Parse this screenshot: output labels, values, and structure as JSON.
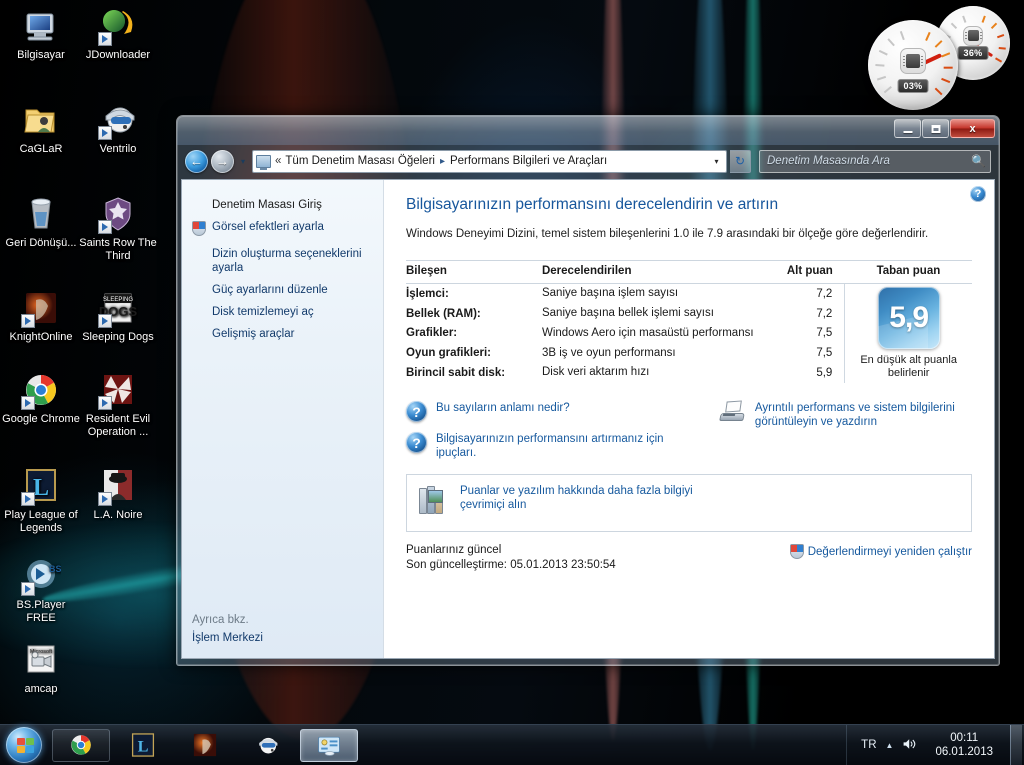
{
  "desktop": {
    "icons": [
      {
        "label": "Bilgisayar",
        "icon": "computer-icon",
        "shortcut": false
      },
      {
        "label": "JDownloader",
        "icon": "jdownloader-icon",
        "shortcut": true
      },
      {
        "label": "CaGLaR",
        "icon": "user-folder-icon",
        "shortcut": false
      },
      {
        "label": "Ventrilo",
        "icon": "ventrilo-icon",
        "shortcut": true
      },
      {
        "label": "Geri Dönüşü...",
        "icon": "recycle-bin-icon",
        "shortcut": false
      },
      {
        "label": "Saints Row The Third",
        "icon": "saints-row-icon",
        "shortcut": true
      },
      {
        "label": "KnightOnline",
        "icon": "knightonline-icon",
        "shortcut": true
      },
      {
        "label": "Sleeping Dogs",
        "icon": "sleeping-dogs-icon",
        "shortcut": true
      },
      {
        "label": "Google Chrome",
        "icon": "chrome-icon",
        "shortcut": true
      },
      {
        "label": "Resident Evil Operation ...",
        "icon": "resident-evil-icon",
        "shortcut": true
      },
      {
        "label": "Play League of Legends",
        "icon": "league-of-legends-icon",
        "shortcut": true
      },
      {
        "label": "L.A. Noire",
        "icon": "la-noire-icon",
        "shortcut": true
      },
      {
        "label": "BS.Player FREE",
        "icon": "bsplayer-icon",
        "shortcut": true
      },
      {
        "label": "amcap",
        "icon": "amcap-icon",
        "shortcut": false
      }
    ]
  },
  "gadget": {
    "cpu_value": "03%",
    "ram_value": "36%",
    "cpu_icon": "cpu-chip-icon",
    "ram_icon": "memory-chip-icon"
  },
  "window": {
    "controls": {
      "minimize": "minimize-button",
      "maximize": "maximize-button",
      "close_label": "x"
    },
    "nav": {
      "back_glyph": "←",
      "forward_glyph": "→",
      "recent_glyph": "▾",
      "refresh_glyph": "↻"
    },
    "address": {
      "chevrons": "«",
      "crumbs": [
        "Tüm Denetim Masası Öğeleri",
        "Performans Bilgileri ve Araçları"
      ],
      "separator": "▸",
      "dropdown_glyph": "▾"
    },
    "search": {
      "placeholder": "Denetim Masasında Ara",
      "icon": "search-icon"
    },
    "help_label": "?"
  },
  "sidebar": {
    "items": [
      {
        "label": "Denetim Masası Giriş",
        "icon": null
      },
      {
        "label": "Görsel efektleri ayarla",
        "icon": "uac-shield-icon"
      },
      {
        "label": "Dizin oluşturma seçeneklerini ayarla",
        "icon": null
      },
      {
        "label": "Güç ayarlarını düzenle",
        "icon": null
      },
      {
        "label": "Disk temizlemeyi aç",
        "icon": null
      },
      {
        "label": "Gelişmiş araçlar",
        "icon": null
      }
    ],
    "footer_header": "Ayrıca bkz.",
    "footer_link": "İşlem Merkezi"
  },
  "main": {
    "title": "Bilgisayarınızın performansını derecelendirin ve artırın",
    "subtitle": "Windows Deneyimi Dizini, temel sistem bileşenlerini 1.0 ile 7.9 arasındaki bir ölçeğe göre değerlendirir.",
    "table": {
      "headers": [
        "Bileşen",
        "Derecelendirilen",
        "Alt puan",
        "Taban puan"
      ],
      "rows": [
        {
          "component": "İşlemci:",
          "rated": "Saniye başına işlem sayısı",
          "subscore": "7,2"
        },
        {
          "component": "Bellek (RAM):",
          "rated": "Saniye başına bellek işlemi sayısı",
          "subscore": "7,2"
        },
        {
          "component": "Grafikler:",
          "rated": "Windows Aero için masaüstü performansı",
          "subscore": "7,5"
        },
        {
          "component": "Oyun grafikleri:",
          "rated": "3B iş ve oyun performansı",
          "subscore": "7,5"
        },
        {
          "component": "Birincil sabit disk:",
          "rated": "Disk veri aktarım hızı",
          "subscore": "5,9"
        }
      ],
      "base_score": "5,9",
      "base_caption": "En düşük alt puanla belirlenir"
    },
    "links": [
      {
        "label": "Bu sayıların anlamı nedir?",
        "icon": "help-circle-icon"
      },
      {
        "label": "Bilgisayarınızın performansını artırmanız için ipuçları.",
        "icon": "help-circle-icon"
      }
    ],
    "print_link": {
      "label": "Ayrıntılı performans ve sistem bilgilerini görüntüleyin ve yazdırın",
      "icon": "printer-icon"
    },
    "online_panel": {
      "label": "Puanlar ve yazılım hakkında daha fazla bilgiyi çevrimiçi alın",
      "icon": "books-icon"
    },
    "status": {
      "line1": "Puanlarınız güncel",
      "line2": "Son güncelleştirme: 05.01.2013 23:50:54"
    },
    "rerun": {
      "label": "Değerlendirmeyi yeniden çalıştır",
      "icon": "uac-shield-icon"
    }
  },
  "taskbar": {
    "start": {
      "name": "start-orb"
    },
    "buttons": [
      {
        "name": "taskbar-chrome",
        "icon": "chrome-icon",
        "active": false
      },
      {
        "name": "taskbar-lol",
        "icon": "league-of-legends-icon",
        "active": false
      },
      {
        "name": "taskbar-knightonline",
        "icon": "knightonline-icon",
        "active": false
      },
      {
        "name": "taskbar-ventrilo",
        "icon": "ventrilo-icon",
        "active": false
      },
      {
        "name": "taskbar-control-panel",
        "icon": "performance-icon",
        "active": true
      }
    ],
    "tray": {
      "language": "TR",
      "caret_glyph": "▲",
      "volume_glyph": "🔊",
      "time": "00:11",
      "date": "06.01.2013"
    }
  }
}
